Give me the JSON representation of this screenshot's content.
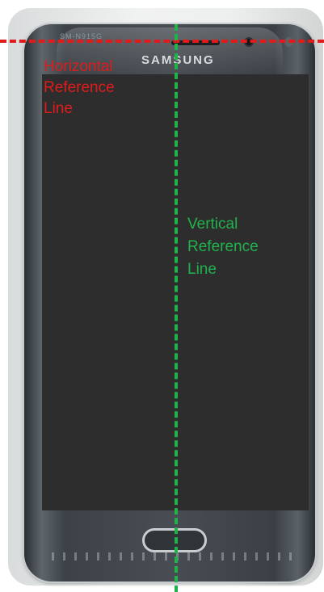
{
  "device": {
    "brand": "SAMSUNG",
    "model_text": "SM-N915G"
  },
  "reference_lines": {
    "horizontal": {
      "label": "Horizontal\nReference\nLine",
      "color": "#e01b1b"
    },
    "vertical": {
      "label": "Vertical\nReference\nLine",
      "color": "#22b24c"
    }
  },
  "colors": {
    "screen": "#2d2d2d",
    "body": "#474d52"
  }
}
